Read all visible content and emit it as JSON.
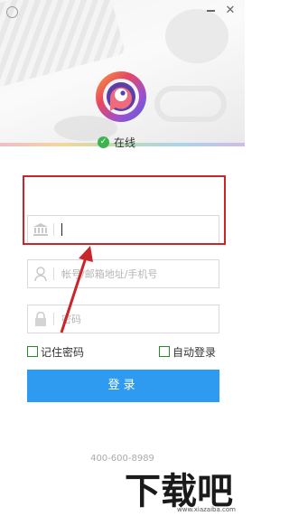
{
  "status": {
    "text": "在线"
  },
  "fields": {
    "server_value": "",
    "account_placeholder": "帐号/邮箱地址/手机号",
    "password_placeholder": "密码"
  },
  "options": {
    "remember_label": "记住密码",
    "auto_login_label": "自动登录"
  },
  "login": {
    "label": "登录"
  },
  "footer": {
    "phone": "400-600-8989"
  },
  "watermark": {
    "logo_text": "下载吧",
    "url": "www.xiazaiba.com"
  },
  "colors": {
    "accent": "#2e9bf0",
    "status_green": "#3fb34f",
    "highlight_red": "#c8262a"
  },
  "icons": {
    "app": "circle-window-icon",
    "server": "bank-building-icon",
    "account": "user-icon",
    "password": "lock-icon"
  }
}
